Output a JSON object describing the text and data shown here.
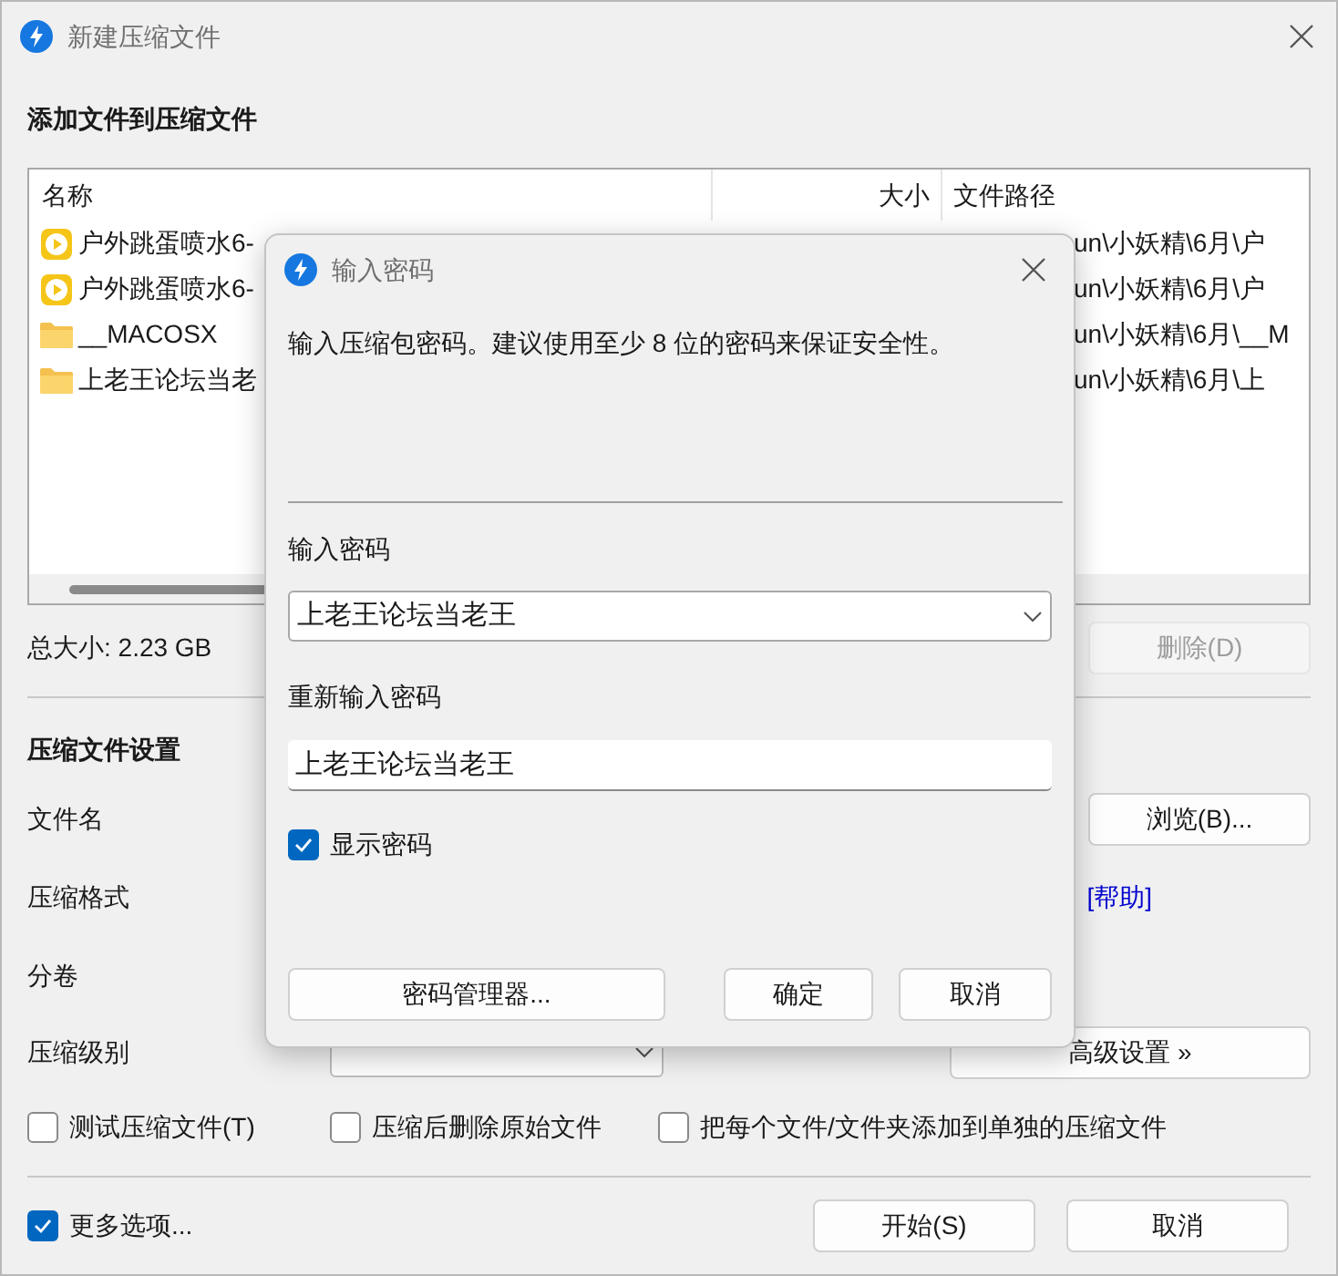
{
  "window": {
    "title": "新建压缩文件"
  },
  "files": {
    "heading": "添加文件到压缩文件",
    "columns": [
      "名称",
      "大小",
      "文件路径"
    ],
    "rows": [
      {
        "kind": "video",
        "name": "户外跳蛋喷水6-",
        "path": "un\\小妖精\\6月\\户"
      },
      {
        "kind": "video",
        "name": "户外跳蛋喷水6-",
        "path": "un\\小妖精\\6月\\户"
      },
      {
        "kind": "folder",
        "name": "__MACOSX",
        "path": "un\\小妖精\\6月\\__M"
      },
      {
        "kind": "folder",
        "name": "上老王论坛当老",
        "path": "un\\小妖精\\6月\\上"
      }
    ]
  },
  "total_size": "总大小: 2.23 GB",
  "delete_button": {
    "label": "删除(D)",
    "disabled": true
  },
  "settings": {
    "heading": "压缩文件设置",
    "labels": [
      "文件名",
      "压缩格式",
      "分卷",
      "压缩级别"
    ],
    "browse_button": "浏览(B)...",
    "help_link": "[帮助]",
    "advanced_button": "高级设置 »"
  },
  "options": [
    {
      "label": "测试压缩文件(T)",
      "checked": false
    },
    {
      "label": "压缩后删除原始文件",
      "checked": false
    },
    {
      "label": "把每个文件/文件夹添加到单独的压缩文件",
      "checked": false
    }
  ],
  "more_options": {
    "label": "更多选项...",
    "checked": true
  },
  "buttons": [
    "开始(S)",
    "取消"
  ],
  "dialog": {
    "title": "输入密码",
    "message": "输入压缩包密码。建议使用至少 8 位的密码来保证安全性。",
    "password_label": "输入密码",
    "password": "上老王论坛当老王",
    "confirm_label": "重新输入密码",
    "confirm": "上老王论坛当老王",
    "show_password": {
      "label": "显示密码",
      "checked": true
    },
    "buttons": [
      "密码管理器...",
      "确定",
      "取消"
    ]
  }
}
